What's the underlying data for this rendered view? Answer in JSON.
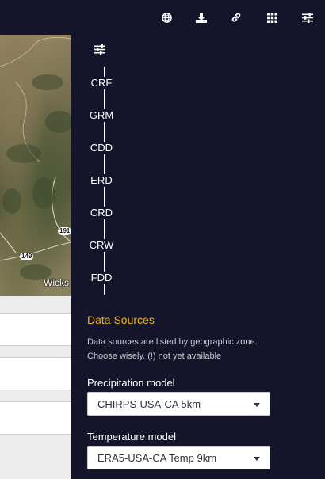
{
  "toolbar": {
    "icons": [
      "globe-icon",
      "download-icon",
      "link-icon",
      "grid-icon",
      "sliders-icon"
    ]
  },
  "map": {
    "place_label": "Wicks",
    "road_labels": [
      "191",
      "149"
    ]
  },
  "indices": {
    "items": [
      "CRF",
      "GRM",
      "CDD",
      "ERD",
      "CRD",
      "CRW",
      "FDD"
    ]
  },
  "data_sources": {
    "title": "Data Sources",
    "description": "Data sources are listed by geographic zone. Choose wisely. (!) not yet available",
    "precipitation": {
      "label": "Precipitation model",
      "value": "CHIRPS-USA-CA 5km"
    },
    "temperature": {
      "label": "Temperature model",
      "value": "ERA5-USA-CA Temp 9km"
    }
  },
  "colors": {
    "background": "#14152a",
    "accent": "#f0b41c"
  }
}
